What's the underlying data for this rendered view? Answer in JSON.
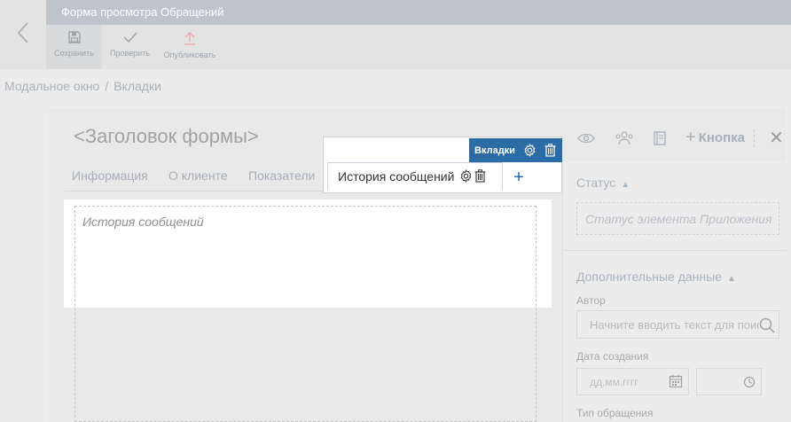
{
  "window": {
    "title": "Форма просмотра Обращений"
  },
  "toolbar": {
    "save_label": "Сохранить",
    "check_label": "Проверить",
    "publish_label": "Опубликовать"
  },
  "breadcrumb": [
    "Модальное окно",
    "Вкладки"
  ],
  "form": {
    "title": "<Заголовок формы>",
    "add_button_label": "Кнопка",
    "close_glyph": "✕",
    "tabs": [
      "Информация",
      "О клиенте",
      "Показатели"
    ],
    "active_tab": "История сообщений",
    "tabs_widget_label": "Вкладки",
    "add_tab_glyph": "+",
    "content_placeholder": "История сообщений"
  },
  "right_panel": {
    "status_title": "Статус",
    "status_placeholder": "Статус элемента Приложения",
    "extra_title": "Дополнительные данные",
    "author_label": "Автор",
    "author_placeholder": "Начните вводить текст для поиска",
    "date_label": "Дата создания",
    "date_placeholder": "дд.мм.гггг",
    "type_label": "Тип обращения"
  },
  "icons": {
    "back": "chevron-left-icon",
    "save": "floppy-disk-icon",
    "check": "checkmark-icon",
    "publish": "upload-arrow-icon",
    "preview": "eye-icon",
    "users": "users-icon",
    "document": "document-icon",
    "settings": "gear-icon",
    "delete": "trash-icon",
    "search": "search-icon",
    "calendar": "calendar-icon",
    "clock": "clock-icon"
  },
  "colors": {
    "accent": "#2b6ba6",
    "titlebar": "#bfc4cc",
    "publish_icon": "#f1a5a5"
  }
}
